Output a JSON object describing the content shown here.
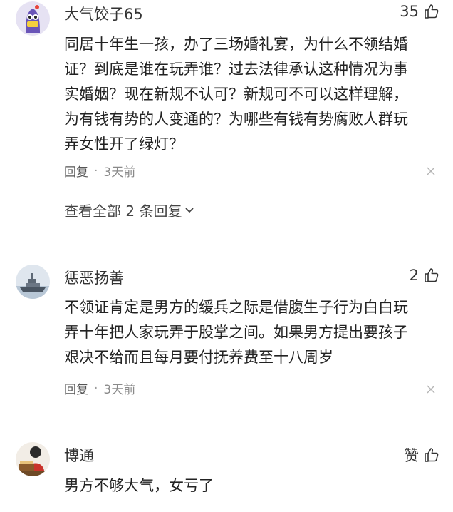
{
  "comments": [
    {
      "user": "大气饺子65",
      "likes": "35",
      "lines": [
        "同居十年生一孩，办了三场婚礼宴，为什么不领结婚",
        "证？到底是谁在玩弄谁？过去法律承认这种情况为事",
        "实婚姻？现在新规不认可？新规可不可以这样理解，",
        "为有钱有势的人变通的？为哪些有钱有势腐败人群玩",
        "弄女性开了绿灯？"
      ],
      "reply_label": "回复",
      "time": "3天前",
      "view_replies": "查看全部 2 条回复"
    },
    {
      "user": "惩恶扬善",
      "likes": "2",
      "lines": [
        "不领证肯定是男方的缓兵之际是借腹生子行为白白玩",
        "弄十年把人家玩弄于股掌之间。如果男方提出要孩子",
        "艰决不给而且每月要付抚养费至十八周岁"
      ],
      "reply_label": "回复",
      "time": "3天前"
    },
    {
      "user": "博通",
      "likes": "赞",
      "lines": [
        "男方不够大气，女亏了"
      ]
    }
  ],
  "separator": "·",
  "icons": {
    "like": "thumbs-up-icon",
    "close": "close-icon",
    "chevron": "chevron-down-icon"
  }
}
